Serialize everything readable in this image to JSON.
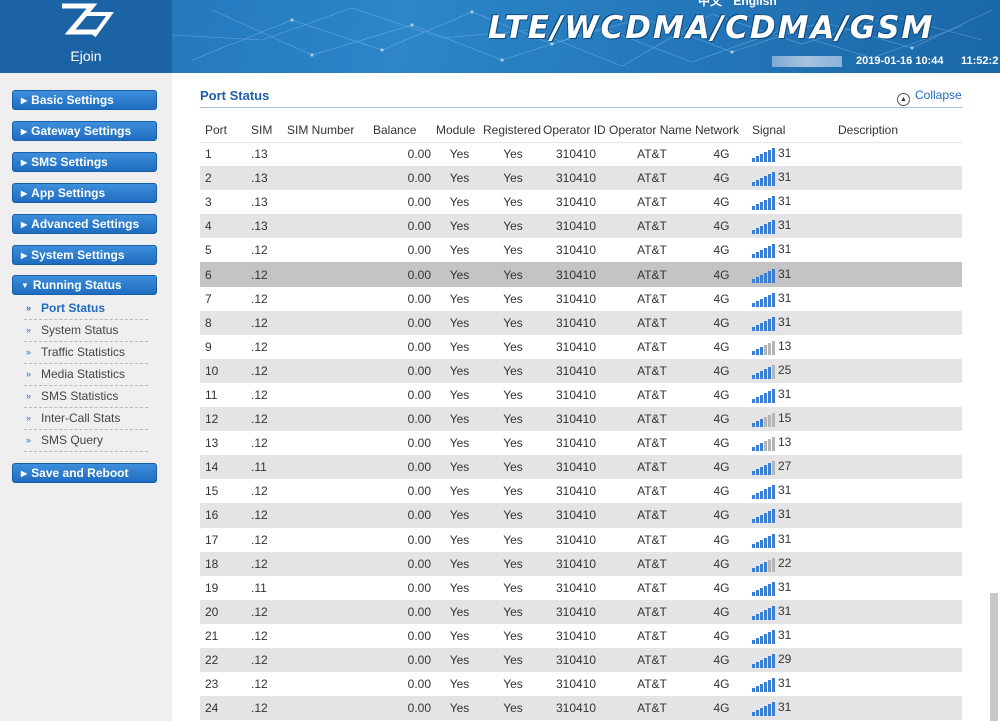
{
  "brand": {
    "logo_text": "Ejoin",
    "banner": "LTE/WCDMA/CDMA/GSM"
  },
  "top_links": {
    "lang_cn": "中文",
    "lang_en": "English"
  },
  "datetime": {
    "date": "2019-01-16 10:44",
    "time": "11:52:2"
  },
  "colors": {
    "accent": "#1f6bc1",
    "header": "#1f6fb4",
    "signal_on": "#3a7fd1",
    "signal_off": "#b5b5b5",
    "row_alt": "#e4e4e4",
    "row_highlight": "#c4c4c4"
  },
  "sidebar": {
    "menus": [
      {
        "label": "Basic Settings"
      },
      {
        "label": "Gateway Settings"
      },
      {
        "label": "SMS Settings"
      },
      {
        "label": "App Settings"
      },
      {
        "label": "Advanced Settings"
      },
      {
        "label": "System Settings"
      },
      {
        "label": "Running Status"
      },
      {
        "label": "Save and Reboot"
      }
    ],
    "sub_items": [
      {
        "label": "Port Status",
        "active": true
      },
      {
        "label": "System Status"
      },
      {
        "label": "Traffic Statistics"
      },
      {
        "label": "Media Statistics"
      },
      {
        "label": "SMS Statistics"
      },
      {
        "label": "Inter-Call Stats"
      },
      {
        "label": "SMS Query"
      }
    ]
  },
  "main": {
    "title": "Port Status",
    "collapse_label": "Collapse",
    "columns": [
      "Port",
      "SIM",
      "SIM Number",
      "Balance",
      "Module",
      "Registered",
      "Operator ID",
      "Operator Name",
      "Network",
      "Signal",
      "Description"
    ],
    "rows": [
      {
        "port": "1",
        "sim": ".13",
        "simnum": "",
        "balance": "0.00",
        "module": "Yes",
        "registered": "Yes",
        "op_id": "310410",
        "op_name": "AT&T",
        "network": "4G",
        "signal": "31",
        "desc": ""
      },
      {
        "port": "2",
        "sim": ".13",
        "simnum": "",
        "balance": "0.00",
        "module": "Yes",
        "registered": "Yes",
        "op_id": "310410",
        "op_name": "AT&T",
        "network": "4G",
        "signal": "31",
        "desc": ""
      },
      {
        "port": "3",
        "sim": ".13",
        "simnum": "",
        "balance": "0.00",
        "module": "Yes",
        "registered": "Yes",
        "op_id": "310410",
        "op_name": "AT&T",
        "network": "4G",
        "signal": "31",
        "desc": ""
      },
      {
        "port": "4",
        "sim": ".13",
        "simnum": "",
        "balance": "0.00",
        "module": "Yes",
        "registered": "Yes",
        "op_id": "310410",
        "op_name": "AT&T",
        "network": "4G",
        "signal": "31",
        "desc": ""
      },
      {
        "port": "5",
        "sim": ".12",
        "simnum": "",
        "balance": "0.00",
        "module": "Yes",
        "registered": "Yes",
        "op_id": "310410",
        "op_name": "AT&T",
        "network": "4G",
        "signal": "31",
        "desc": ""
      },
      {
        "port": "6",
        "sim": ".12",
        "simnum": "",
        "balance": "0.00",
        "module": "Yes",
        "registered": "Yes",
        "op_id": "310410",
        "op_name": "AT&T",
        "network": "4G",
        "signal": "31",
        "desc": "",
        "highlight": true
      },
      {
        "port": "7",
        "sim": ".12",
        "simnum": "",
        "balance": "0.00",
        "module": "Yes",
        "registered": "Yes",
        "op_id": "310410",
        "op_name": "AT&T",
        "network": "4G",
        "signal": "31",
        "desc": ""
      },
      {
        "port": "8",
        "sim": ".12",
        "simnum": "",
        "balance": "0.00",
        "module": "Yes",
        "registered": "Yes",
        "op_id": "310410",
        "op_name": "AT&T",
        "network": "4G",
        "signal": "31",
        "desc": ""
      },
      {
        "port": "9",
        "sim": ".12",
        "simnum": "",
        "balance": "0.00",
        "module": "Yes",
        "registered": "Yes",
        "op_id": "310410",
        "op_name": "AT&T",
        "network": "4G",
        "signal": "13",
        "desc": ""
      },
      {
        "port": "10",
        "sim": ".12",
        "simnum": "",
        "balance": "0.00",
        "module": "Yes",
        "registered": "Yes",
        "op_id": "310410",
        "op_name": "AT&T",
        "network": "4G",
        "signal": "25",
        "desc": ""
      },
      {
        "port": "11",
        "sim": ".12",
        "simnum": "",
        "balance": "0.00",
        "module": "Yes",
        "registered": "Yes",
        "op_id": "310410",
        "op_name": "AT&T",
        "network": "4G",
        "signal": "31",
        "desc": ""
      },
      {
        "port": "12",
        "sim": ".12",
        "simnum": "",
        "balance": "0.00",
        "module": "Yes",
        "registered": "Yes",
        "op_id": "310410",
        "op_name": "AT&T",
        "network": "4G",
        "signal": "15",
        "desc": ""
      },
      {
        "port": "13",
        "sim": ".12",
        "simnum": "",
        "balance": "0.00",
        "module": "Yes",
        "registered": "Yes",
        "op_id": "310410",
        "op_name": "AT&T",
        "network": "4G",
        "signal": "13",
        "desc": ""
      },
      {
        "port": "14",
        "sim": ".11",
        "simnum": "",
        "balance": "0.00",
        "module": "Yes",
        "registered": "Yes",
        "op_id": "310410",
        "op_name": "AT&T",
        "network": "4G",
        "signal": "27",
        "desc": ""
      },
      {
        "port": "15",
        "sim": ".12",
        "simnum": "",
        "balance": "0.00",
        "module": "Yes",
        "registered": "Yes",
        "op_id": "310410",
        "op_name": "AT&T",
        "network": "4G",
        "signal": "31",
        "desc": ""
      },
      {
        "port": "16",
        "sim": ".12",
        "simnum": "",
        "balance": "0.00",
        "module": "Yes",
        "registered": "Yes",
        "op_id": "310410",
        "op_name": "AT&T",
        "network": "4G",
        "signal": "31",
        "desc": ""
      },
      {
        "port": "17",
        "sim": ".12",
        "simnum": "",
        "balance": "0.00",
        "module": "Yes",
        "registered": "Yes",
        "op_id": "310410",
        "op_name": "AT&T",
        "network": "4G",
        "signal": "31",
        "desc": ""
      },
      {
        "port": "18",
        "sim": ".12",
        "simnum": "",
        "balance": "0.00",
        "module": "Yes",
        "registered": "Yes",
        "op_id": "310410",
        "op_name": "AT&T",
        "network": "4G",
        "signal": "22",
        "desc": ""
      },
      {
        "port": "19",
        "sim": ".11",
        "simnum": "",
        "balance": "0.00",
        "module": "Yes",
        "registered": "Yes",
        "op_id": "310410",
        "op_name": "AT&T",
        "network": "4G",
        "signal": "31",
        "desc": ""
      },
      {
        "port": "20",
        "sim": ".12",
        "simnum": "",
        "balance": "0.00",
        "module": "Yes",
        "registered": "Yes",
        "op_id": "310410",
        "op_name": "AT&T",
        "network": "4G",
        "signal": "31",
        "desc": ""
      },
      {
        "port": "21",
        "sim": ".12",
        "simnum": "",
        "balance": "0.00",
        "module": "Yes",
        "registered": "Yes",
        "op_id": "310410",
        "op_name": "AT&T",
        "network": "4G",
        "signal": "31",
        "desc": ""
      },
      {
        "port": "22",
        "sim": ".12",
        "simnum": "",
        "balance": "0.00",
        "module": "Yes",
        "registered": "Yes",
        "op_id": "310410",
        "op_name": "AT&T",
        "network": "4G",
        "signal": "29",
        "desc": ""
      },
      {
        "port": "23",
        "sim": ".12",
        "simnum": "",
        "balance": "0.00",
        "module": "Yes",
        "registered": "Yes",
        "op_id": "310410",
        "op_name": "AT&T",
        "network": "4G",
        "signal": "31",
        "desc": ""
      },
      {
        "port": "24",
        "sim": ".12",
        "simnum": "",
        "balance": "0.00",
        "module": "Yes",
        "registered": "Yes",
        "op_id": "310410",
        "op_name": "AT&T",
        "network": "4G",
        "signal": "31",
        "desc": ""
      }
    ]
  }
}
